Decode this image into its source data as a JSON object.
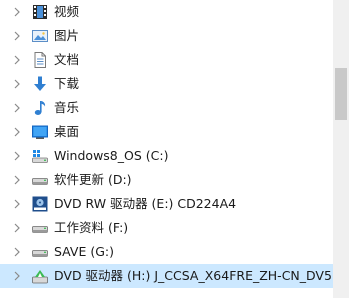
{
  "tree": {
    "items": [
      {
        "label": "视频",
        "icon": "videos-folder-icon"
      },
      {
        "label": "图片",
        "icon": "pictures-folder-icon"
      },
      {
        "label": "文档",
        "icon": "documents-folder-icon"
      },
      {
        "label": "下载",
        "icon": "downloads-folder-icon"
      },
      {
        "label": "音乐",
        "icon": "music-folder-icon"
      },
      {
        "label": "桌面",
        "icon": "desktop-folder-icon"
      },
      {
        "label": "Windows8_OS (C:)",
        "icon": "windows-drive-icon"
      },
      {
        "label": "软件更新 (D:)",
        "icon": "hard-drive-icon"
      },
      {
        "label": "DVD RW 驱动器 (E:) CD224A4",
        "icon": "dvd-rw-drive-icon"
      },
      {
        "label": "工作资料 (F:)",
        "icon": "hard-drive-icon"
      },
      {
        "label": "SAVE (G:)",
        "icon": "hard-drive-icon"
      },
      {
        "label": "DVD 驱动器 (H:) J_CCSA_X64FRE_ZH-CN_DV5",
        "icon": "dvd-drive-icon",
        "selected": true
      }
    ]
  },
  "colors": {
    "selection": "#cce8ff",
    "chevron": "#8a8a8a",
    "folder": "#f5c542"
  }
}
